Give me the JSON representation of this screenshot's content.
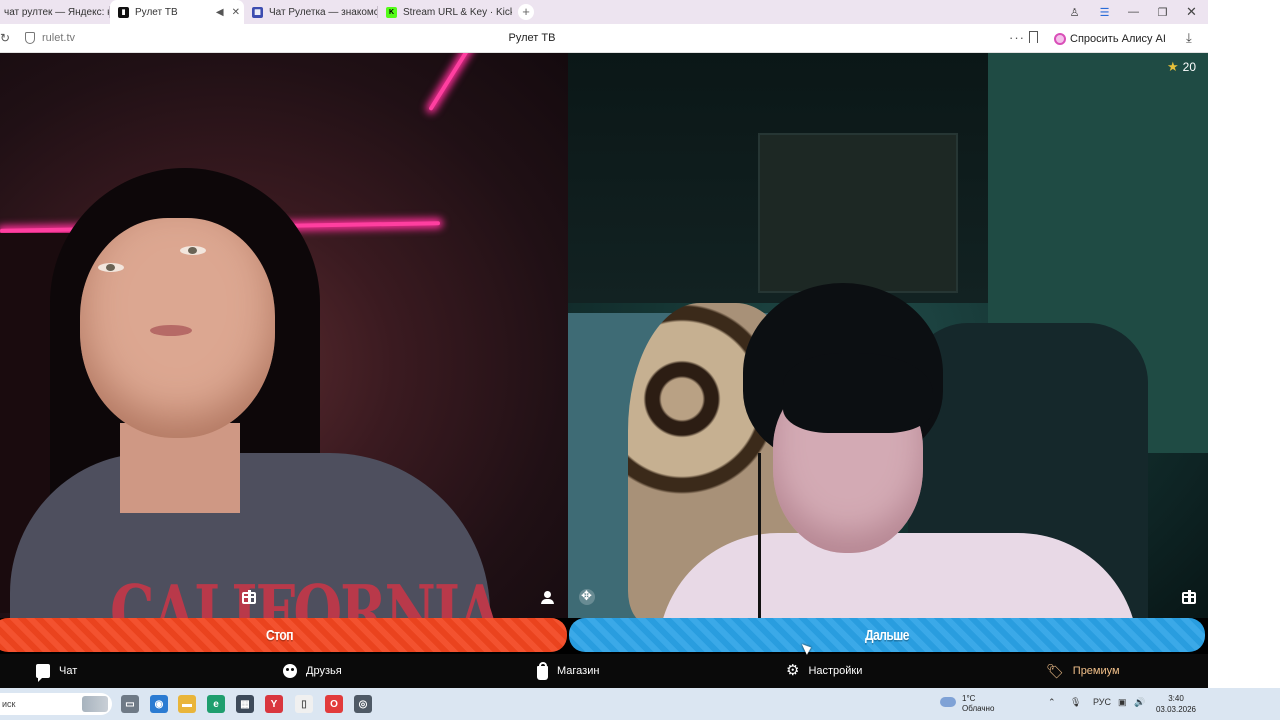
{
  "browser": {
    "tabs": [
      {
        "title": "чат рултек — Яндекс: наш",
        "fav_color": "#ffffff",
        "fav_glyph": ""
      },
      {
        "title": "Рулет ТВ",
        "fav_color": "#111111",
        "fav_glyph": "▮",
        "active": true
      },
      {
        "title": "Чат Рулетка — знакомств",
        "fav_color": "#3d4db0",
        "fav_glyph": "▦"
      },
      {
        "title": "Stream URL & Key · Kick D",
        "fav_color": "#53fc18",
        "fav_glyph": "K"
      }
    ],
    "new_tab_label": "+",
    "url": "rulet.tv",
    "page_title": "Рулет ТВ",
    "alice_label": "Спросить Алису AI"
  },
  "video": {
    "stars_count": "20",
    "left_print": "CALIFORNIA"
  },
  "actions": {
    "stop_label": "Стоп",
    "next_label": "Дальше"
  },
  "nav": {
    "chat": "Чат",
    "friends": "Друзья",
    "shop": "Магазин",
    "settings": "Настройки",
    "premium": "Премиум"
  },
  "taskbar": {
    "search_text": "иск",
    "weather_temp": "1°C",
    "weather_desc": "Облачно",
    "lang": "РУС",
    "time": "3:40",
    "date": "03.03.2026"
  },
  "colors": {
    "stop": "#f2451f",
    "next": "#2aa2e6",
    "premium": "#f2c08a",
    "star": "#e5c03a"
  }
}
